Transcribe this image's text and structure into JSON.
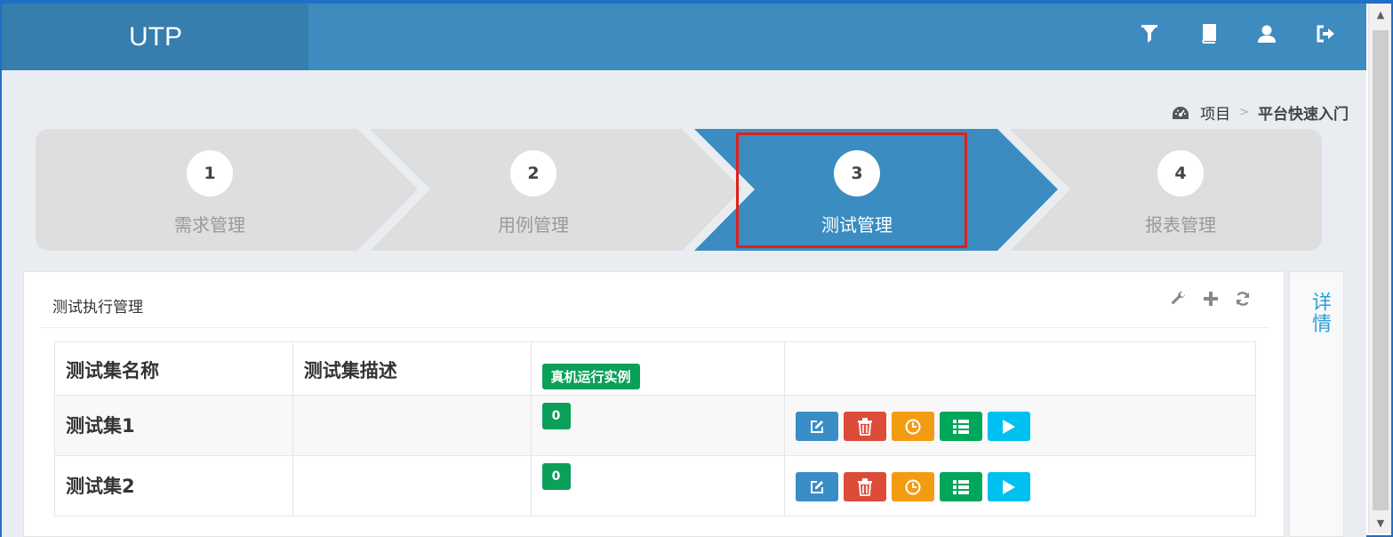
{
  "header": {
    "brand": "UTP",
    "icons": [
      "filter-icon",
      "book-icon",
      "user-icon",
      "logout-icon"
    ]
  },
  "breadcrumb": {
    "icon": "dashboard-icon",
    "root": "项目",
    "separator": ">",
    "current": "平台快速入门"
  },
  "steps": [
    {
      "num": "1",
      "label": "需求管理",
      "active": false
    },
    {
      "num": "2",
      "label": "用例管理",
      "active": false
    },
    {
      "num": "3",
      "label": "测试管理",
      "active": true
    },
    {
      "num": "4",
      "label": "报表管理",
      "active": false
    }
  ],
  "panel": {
    "title": "测试执行管理",
    "tools": [
      "wrench-icon",
      "plus-icon",
      "refresh-icon"
    ],
    "columns": [
      "测试集名称",
      "测试集描述",
      "真机运行实例",
      ""
    ],
    "rows": [
      {
        "name": "测试集1",
        "description": "",
        "count": "0"
      },
      {
        "name": "测试集2",
        "description": "",
        "count": "0"
      }
    ]
  },
  "side_tab": {
    "label": "详情"
  },
  "colors": {
    "header": "#3e8cbf",
    "brand_bg": "#357eae",
    "step_active": "#3a8cc1",
    "step_inactive": "#dedede",
    "highlight": "#e0201b",
    "edit": "#3a8dc6",
    "delete": "#dd4b39",
    "schedule": "#f39c12",
    "list": "#00a65a",
    "run": "#00c0ef"
  }
}
